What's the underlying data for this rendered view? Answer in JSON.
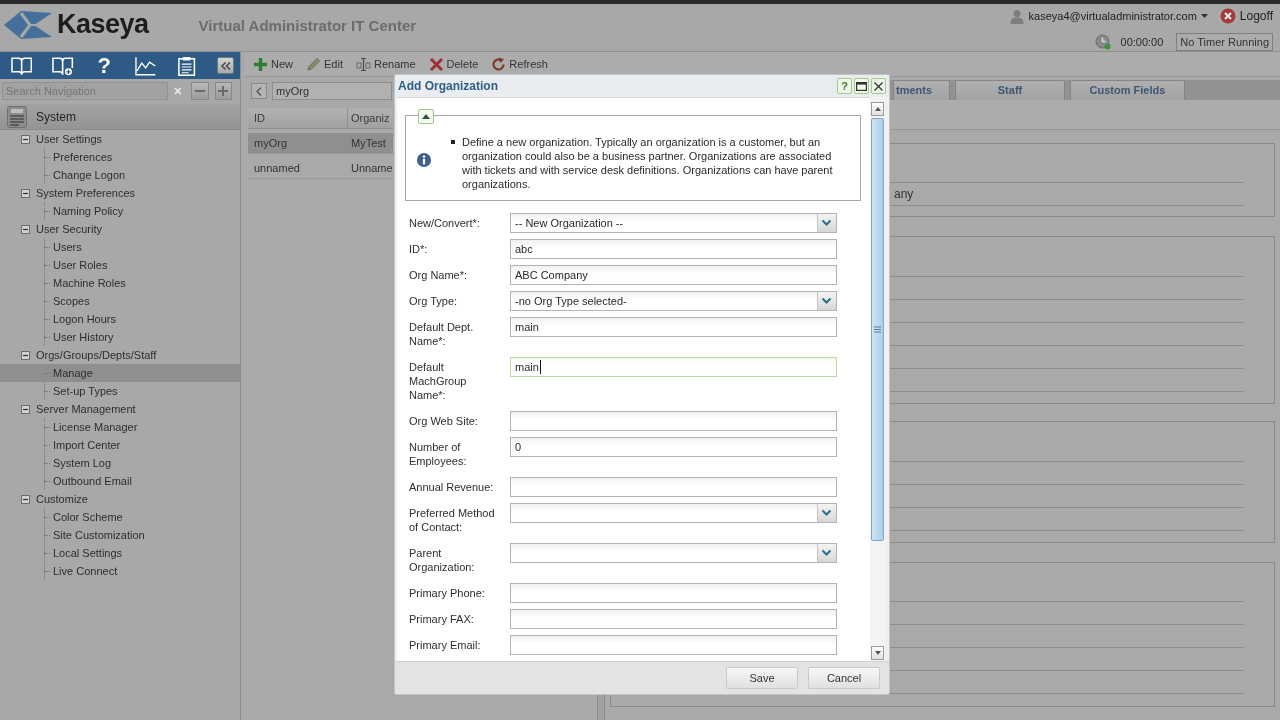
{
  "header": {
    "logo": "Kaseya",
    "title": "Virtual Administrator IT Center",
    "user": "kaseya4@virtualadministrator.com",
    "logoff": "Logoff",
    "timer": "00:00:00",
    "timer_status": "No Timer Running"
  },
  "nav": {
    "help": "?",
    "search": {
      "placeholder": "Search Navigation"
    },
    "module": "System",
    "tree": [
      {
        "label": "User Settings",
        "expanded": true,
        "selected": false,
        "children": [
          {
            "label": "Preferences",
            "selected": false
          },
          {
            "label": "Change Logon",
            "selected": false
          }
        ]
      },
      {
        "label": "System Preferences",
        "expanded": true,
        "selected": false,
        "children": [
          {
            "label": "Naming Policy",
            "selected": false
          }
        ]
      },
      {
        "label": "User Security",
        "expanded": true,
        "selected": false,
        "children": [
          {
            "label": "Users",
            "selected": false
          },
          {
            "label": "User Roles",
            "selected": false
          },
          {
            "label": "Machine Roles",
            "selected": false
          },
          {
            "label": "Scopes",
            "selected": false
          },
          {
            "label": "Logon Hours",
            "selected": false
          },
          {
            "label": "User History",
            "selected": false
          }
        ]
      },
      {
        "label": "Orgs/Groups/Depts/Staff",
        "expanded": true,
        "selected": false,
        "children": [
          {
            "label": "Manage",
            "selected": true
          },
          {
            "label": "Set-up Types",
            "selected": false
          }
        ]
      },
      {
        "label": "Server Management",
        "expanded": true,
        "selected": false,
        "children": [
          {
            "label": "License Manager",
            "selected": false
          },
          {
            "label": "Import Center",
            "selected": false
          },
          {
            "label": "System Log",
            "selected": false
          },
          {
            "label": "Outbound Email",
            "selected": false
          }
        ]
      },
      {
        "label": "Customize",
        "expanded": true,
        "selected": false,
        "children": [
          {
            "label": "Color Scheme",
            "selected": false
          },
          {
            "label": "Site Customization",
            "selected": false
          },
          {
            "label": "Local Settings",
            "selected": false
          },
          {
            "label": "Live Connect",
            "selected": false
          }
        ]
      }
    ]
  },
  "toolbar": [
    "New",
    "Edit",
    "Rename",
    "Delete",
    "Refresh"
  ],
  "filter": {
    "value": "myOrg"
  },
  "table": {
    "columns": [
      "ID",
      "Organiz"
    ],
    "rows": [
      {
        "cells": [
          "myOrg",
          "MyTest"
        ],
        "selected": true
      },
      {
        "cells": [
          "unnamed",
          "Unname"
        ],
        "selected": false
      }
    ]
  },
  "detail": {
    "tabs": [
      {
        "label": "tments",
        "selected": false
      },
      {
        "label": "Staff",
        "selected": false
      },
      {
        "label": "Custom Fields",
        "selected": false
      }
    ],
    "field_fragment": "any"
  },
  "dialog": {
    "title": "Add Organization",
    "help": "?",
    "info": "Define a new organization. Typically an organization is a customer, but an organization could also be a business partner. Organizations are associated with tickets and with service desk definitions. Organizations can have parent organizations.",
    "fields": [
      {
        "label": "New/Convert*:",
        "kind": "select",
        "value": "-- New Organization --",
        "focused": false
      },
      {
        "label": "ID*:",
        "kind": "text",
        "value": "abc",
        "focused": false
      },
      {
        "label": "Org Name*:",
        "kind": "text",
        "value": "ABC Company",
        "focused": false
      },
      {
        "label": "Org Type:",
        "kind": "select",
        "value": "-no Org Type selected-",
        "focused": false
      },
      {
        "label": "Default Dept. Name*:",
        "kind": "text",
        "value": "main",
        "focused": false
      },
      {
        "label": "Default MachGroup Name*:",
        "kind": "text",
        "value": "main",
        "focused": true
      },
      {
        "label": "Org Web Site:",
        "kind": "text",
        "focused": false
      },
      {
        "label": "Number of Employees:",
        "kind": "text",
        "value": "0",
        "focused": false
      },
      {
        "label": "Annual Revenue:",
        "kind": "text",
        "focused": false
      },
      {
        "label": "Preferred Method of Contact:",
        "kind": "select",
        "focused": false
      },
      {
        "label": "Parent Organization:",
        "kind": "select",
        "focused": false
      },
      {
        "label": "Primary Phone:",
        "kind": "text",
        "focused": false
      },
      {
        "label": "Primary FAX:",
        "kind": "text",
        "focused": false
      },
      {
        "label": "Primary Email:",
        "kind": "text",
        "focused": false
      }
    ],
    "buttons": [
      "Save",
      "Cancel"
    ]
  }
}
